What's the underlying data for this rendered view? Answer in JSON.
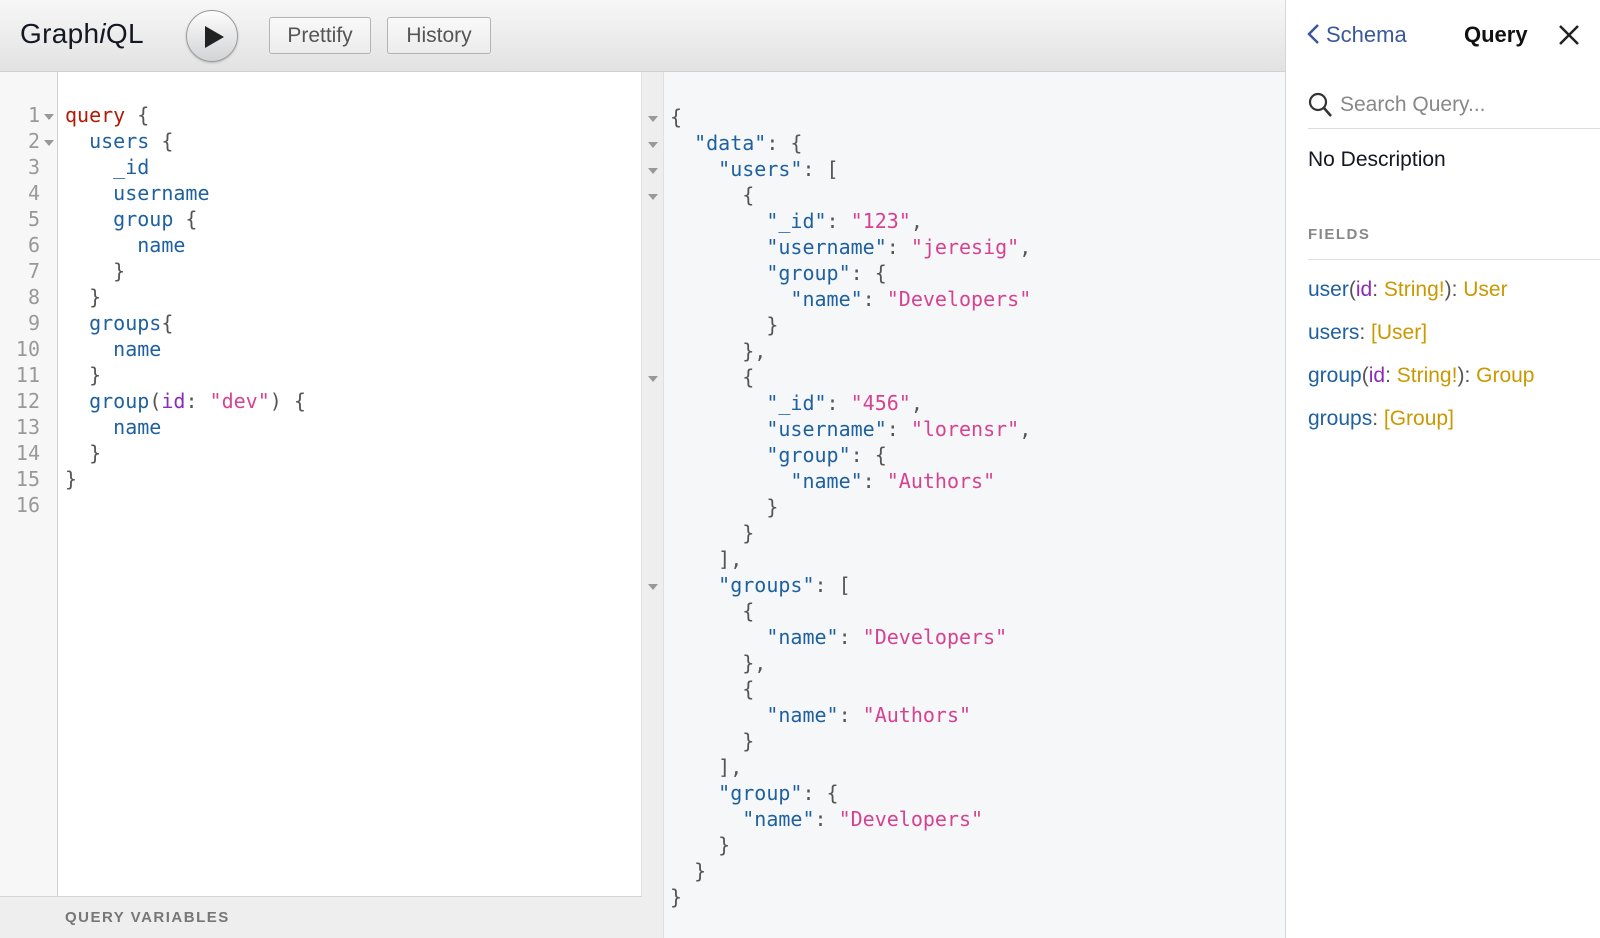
{
  "toolbar": {
    "logo_prefix": "Graph",
    "logo_i": "i",
    "logo_suffix": "QL",
    "prettify_label": "Prettify",
    "history_label": "History",
    "run_icon": "play-icon"
  },
  "query_editor": {
    "line_numbers": [
      "1",
      "2",
      "3",
      "4",
      "5",
      "6",
      "7",
      "8",
      "9",
      "10",
      "11",
      "12",
      "13",
      "14",
      "15",
      "16"
    ],
    "tokens": {
      "query": "query",
      "users": "users",
      "id": "_id",
      "username": "username",
      "group": "group",
      "name": "name",
      "groups": "groups",
      "arg_id": "id",
      "dev": "\"dev\""
    }
  },
  "variables": {
    "title": "QUERY VARIABLES"
  },
  "result": {
    "keys": {
      "data": "\"data\"",
      "users": "\"users\"",
      "id": "\"_id\"",
      "username": "\"username\"",
      "group": "\"group\"",
      "name": "\"name\"",
      "groups": "\"groups\""
    },
    "values": {
      "id1": "\"123\"",
      "user1": "\"jeresig\"",
      "dev": "\"Developers\"",
      "id2": "\"456\"",
      "user2": "\"lorensr\"",
      "authors": "\"Authors\""
    }
  },
  "doc_explorer": {
    "back_label": "Schema",
    "title": "Query",
    "search_placeholder": "Search Query...",
    "description": "No Description",
    "fields_title": "FIELDS",
    "fields": [
      {
        "name": "user",
        "args": [
          {
            "name": "id",
            "type": "String!"
          }
        ],
        "type": "User"
      },
      {
        "name": "users",
        "args": [],
        "type": "[User]"
      },
      {
        "name": "group",
        "args": [
          {
            "name": "id",
            "type": "String!"
          }
        ],
        "type": "Group"
      },
      {
        "name": "groups",
        "args": [],
        "type": "[Group]"
      }
    ]
  },
  "colors": {
    "keyword": "#b11a04",
    "field": "#1f61a0",
    "argument": "#8b2bb9",
    "string": "#d64292",
    "type": "#ca9800",
    "link": "#3b5998"
  }
}
